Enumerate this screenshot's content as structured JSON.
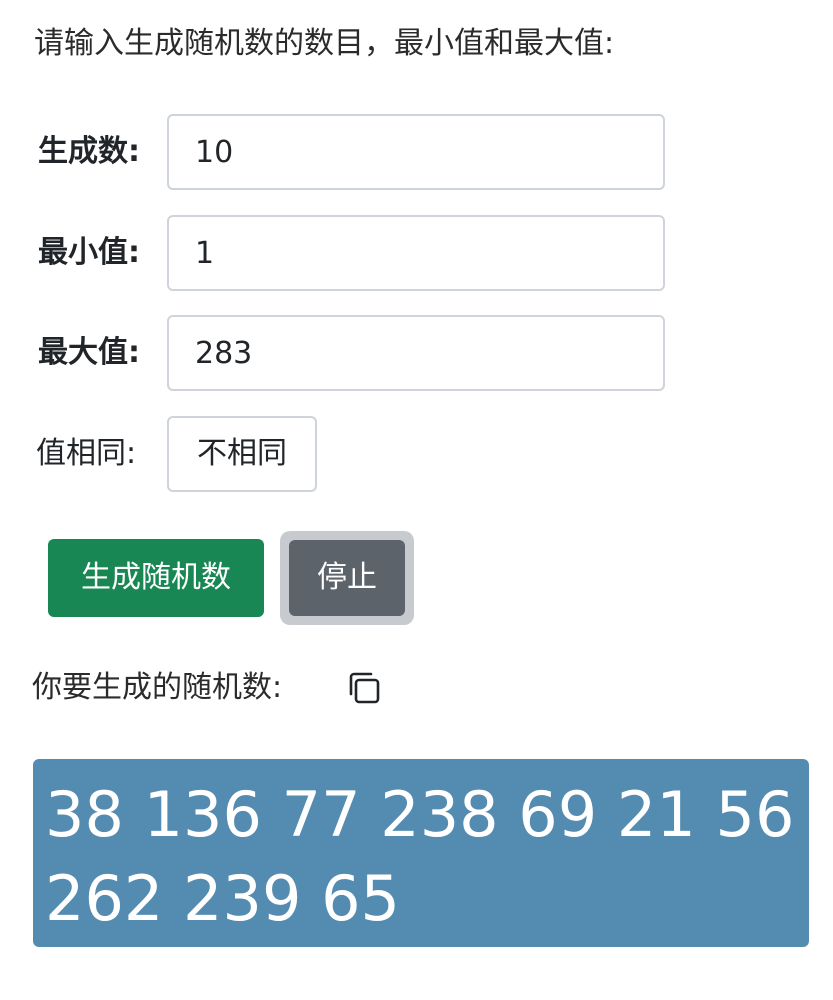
{
  "intro_text": "请输入生成随机数的数目，最小值和最大值:",
  "fields": {
    "count": {
      "label": "生成数:",
      "value": "10"
    },
    "min": {
      "label": "最小值:",
      "value": "1"
    },
    "max": {
      "label": "最大值:",
      "value": "283"
    }
  },
  "same_value": {
    "label": "值相同:",
    "selected": "不相同"
  },
  "buttons": {
    "generate_label": "生成随机数",
    "stop_label": "停止"
  },
  "result": {
    "label": "你要生成的随机数:",
    "numbers_text": "38 136 77 238 69 21 56 262 239 65"
  },
  "icons": {
    "copy": "copy-icon"
  },
  "colors": {
    "generate_button": "#198754",
    "stop_button": "#5c636a",
    "result_background": "#548cb1"
  }
}
